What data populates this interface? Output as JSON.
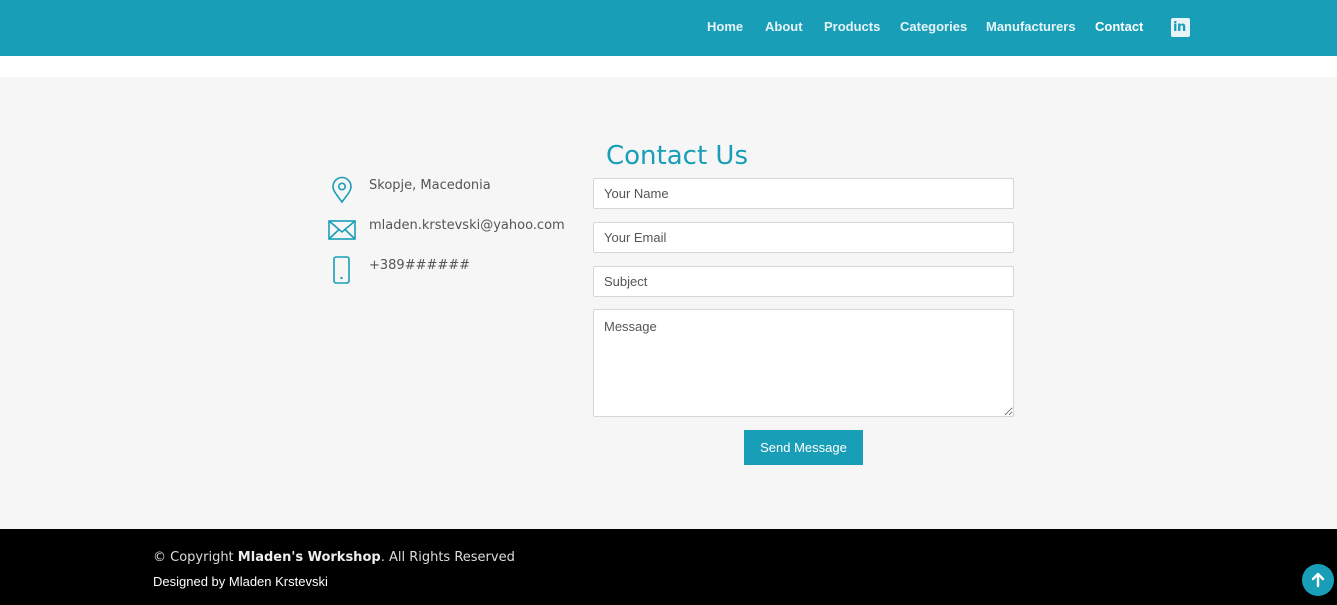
{
  "colors": {
    "accent": "#199eb8",
    "background": "#f6f6f6",
    "footer": "#000000"
  },
  "nav": {
    "items": [
      {
        "label": "Home"
      },
      {
        "label": "About"
      },
      {
        "label": "Products"
      },
      {
        "label": "Categories"
      },
      {
        "label": "Manufacturers"
      },
      {
        "label": "Contact"
      }
    ],
    "social_icon": "linkedin-icon",
    "social_text": "in"
  },
  "contact": {
    "title": "Contact Us",
    "info": {
      "address": "Skopje, Macedonia",
      "email": "mladen.krstevski@yahoo.com",
      "phone": "+389######"
    },
    "icons": {
      "address": "map-pin-icon",
      "email": "envelope-icon",
      "phone": "phone-icon"
    },
    "form": {
      "name_placeholder": "Your Name",
      "email_placeholder": "Your Email",
      "subject_placeholder": "Subject",
      "message_placeholder": "Message",
      "submit_label": "Send Message"
    }
  },
  "footer": {
    "copyright_prefix": "© Copyright",
    "brand": "Mladen's Workshop",
    "copyright_suffix": ". All Rights Reserved",
    "designed_by": "Designed by Mladen Krstevski",
    "back_to_top_icon": "arrow-up-icon"
  }
}
